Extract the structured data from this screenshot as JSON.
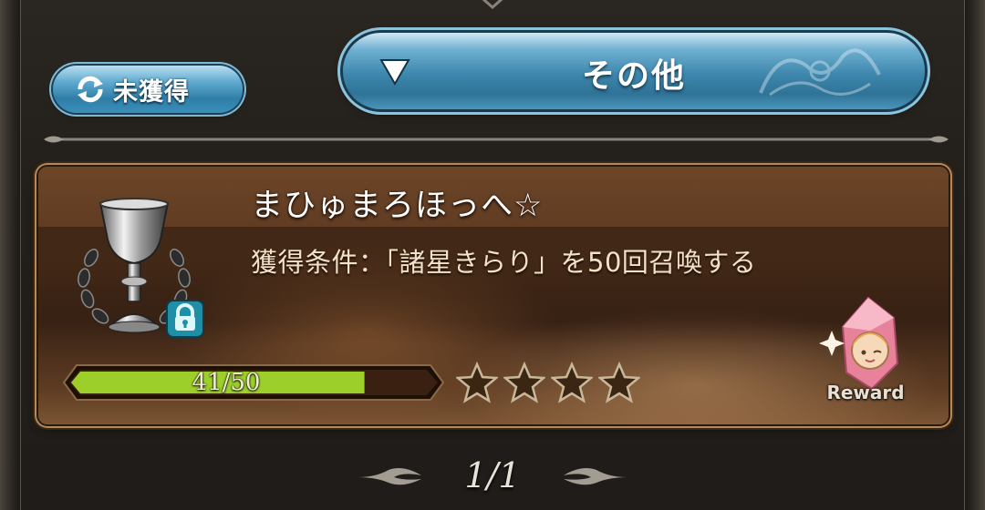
{
  "filter_toggle": {
    "label": "未獲得",
    "icon": "refresh-icon"
  },
  "category_dropdown": {
    "selected": "その他",
    "icon": "triangle-down-icon"
  },
  "achievement": {
    "title": "まひゅまろほっへ☆",
    "condition": "獲得条件：「諸星きらり」を50回召喚する",
    "progress_text": "41/50",
    "progress_current": 41,
    "progress_max": 50,
    "stars": 4,
    "locked": true,
    "trophy_icon": "silver-trophy-icon",
    "reward_label": "Reward"
  },
  "pagination": {
    "text": "1/1"
  },
  "colors": {
    "accent_blue": "#3d86ad",
    "card_brown": "#5a3820",
    "progress_green": "#9ccf2a",
    "lock_teal": "#1f8fa8"
  }
}
